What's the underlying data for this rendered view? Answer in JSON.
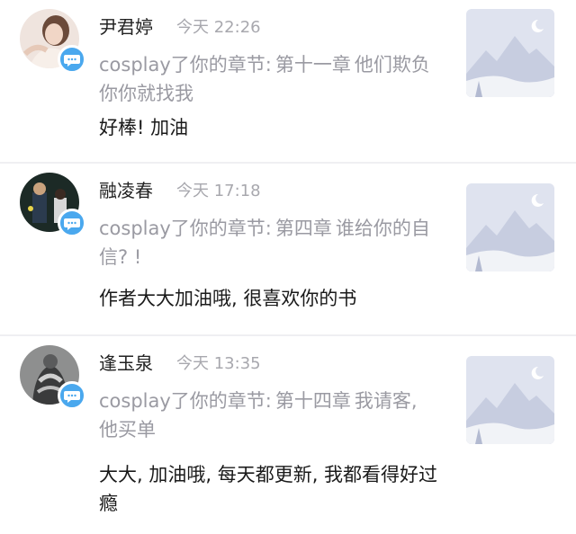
{
  "comments": [
    {
      "name": "尹君婷",
      "time": "今天 22:26",
      "ref_prefix": "cosplay了你的章节:",
      "chapter": "第十一章",
      "chapter_title": "他们欺负你你就找我",
      "text": "好棒! 加油",
      "avatar_icon": "user-photo-icon",
      "badge_icon": "chat-bubble-icon",
      "thumb_icon": "mountain-placeholder-icon"
    },
    {
      "name": "融凌春",
      "time": "今天 17:18",
      "ref_prefix": "cosplay了你的章节:",
      "chapter": "第四章",
      "chapter_title": "谁给你的自信? !",
      "text": "作者大大加油哦, 很喜欢你的书",
      "avatar_icon": "user-photo-icon",
      "badge_icon": "chat-bubble-icon",
      "thumb_icon": "mountain-placeholder-icon"
    },
    {
      "name": "逢玉泉",
      "time": "今天 13:35",
      "ref_prefix": "cosplay了你的章节:",
      "chapter": "第十四章",
      "chapter_title": "我请客, 他买单",
      "text": "大大, 加油哦, 每天都更新, 我都看得好过瘾",
      "avatar_icon": "user-photo-icon",
      "badge_icon": "chat-bubble-icon",
      "thumb_icon": "mountain-placeholder-icon"
    }
  ],
  "colors": {
    "badge": "#4aa8ee",
    "thumb_bg": "#dfe3ef",
    "divider": "#efeff2"
  }
}
